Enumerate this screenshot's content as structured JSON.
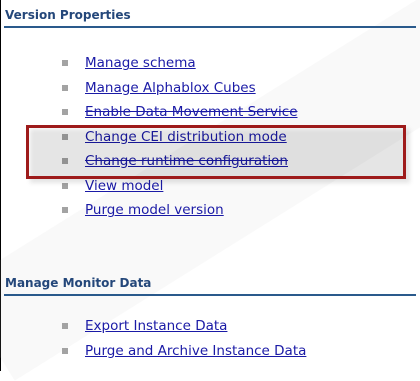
{
  "sections": [
    {
      "title": "Version Properties",
      "links": [
        {
          "label": "Manage schema"
        },
        {
          "label": "Manage Alphablox Cubes"
        },
        {
          "label": "Enable Data Movement Service"
        },
        {
          "label": "Change CEI distribution mode"
        },
        {
          "label": "Change runtime configuration"
        },
        {
          "label": "View model"
        },
        {
          "label": "Purge model version"
        }
      ]
    },
    {
      "title": "Manage Monitor Data",
      "links": [
        {
          "label": "Export Instance Data"
        },
        {
          "label": "Purge and Archive Instance Data"
        }
      ]
    }
  ],
  "colors": {
    "section_title": "#24477a",
    "section_rule": "#2a5a8c",
    "link": "#1a1aa6",
    "bullet": "#a3a3a3",
    "highlight_box": "#9e1b1b"
  }
}
